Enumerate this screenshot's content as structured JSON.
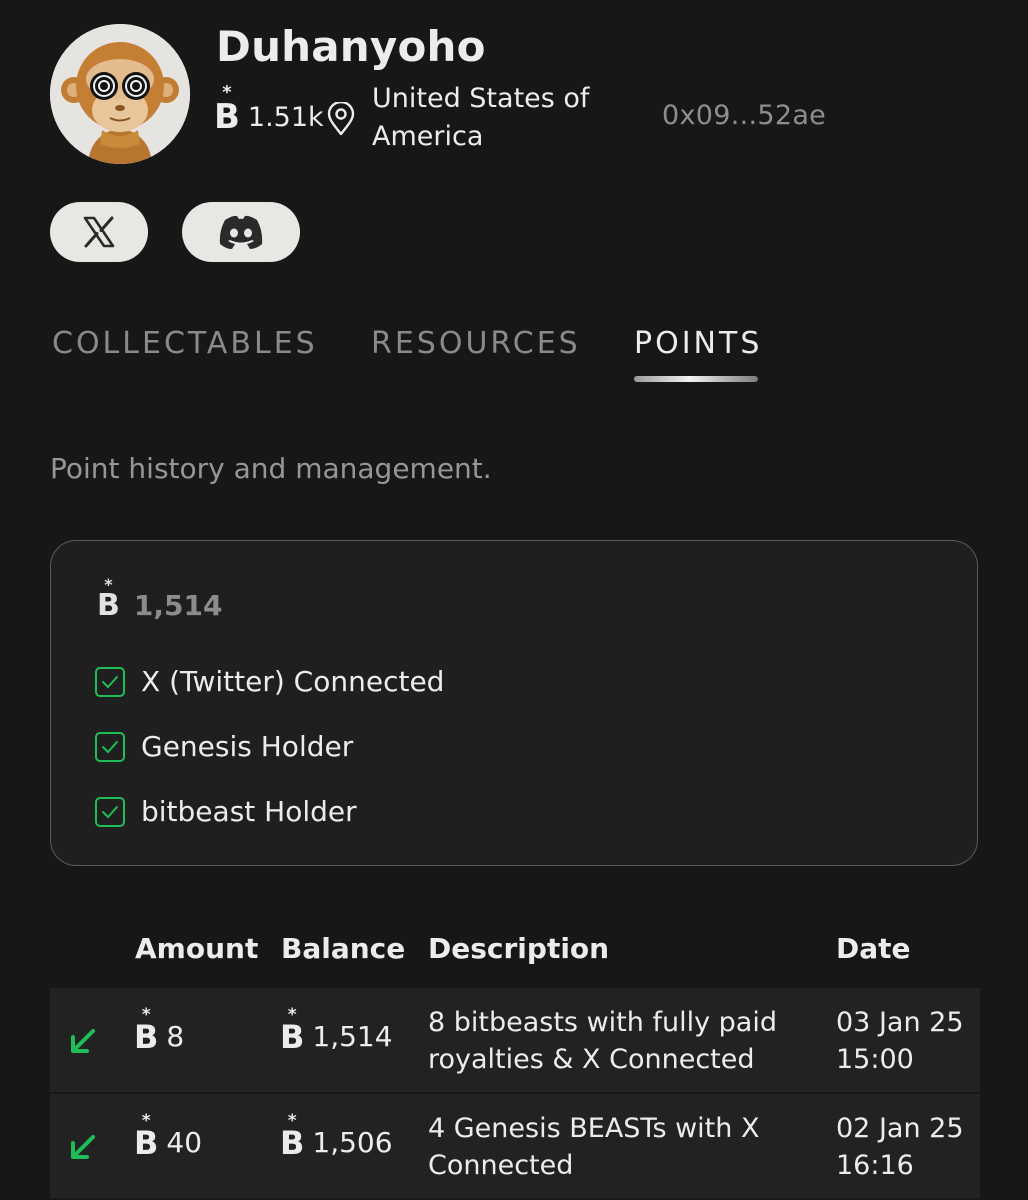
{
  "profile": {
    "name": "Duhanyoho",
    "points": "1.51k",
    "location": "United States of America",
    "wallet": "0x09...52ae"
  },
  "social": {
    "x_icon": "x-logo-icon",
    "discord_icon": "discord-logo-icon"
  },
  "tabs": [
    {
      "label": "COLLECTABLES",
      "active": false
    },
    {
      "label": "RESOURCES",
      "active": false
    },
    {
      "label": "POINTS",
      "active": true
    }
  ],
  "points_page": {
    "subtitle": "Point history and management.",
    "total": "1,514",
    "checks": [
      {
        "label": "X (Twitter) Connected",
        "checked": true
      },
      {
        "label": "Genesis Holder",
        "checked": true
      },
      {
        "label": "bitbeast Holder",
        "checked": true
      }
    ]
  },
  "history": {
    "headers": {
      "amount": "Amount",
      "balance": "Balance",
      "description": "Description",
      "date": "Date"
    },
    "rows": [
      {
        "direction": "incoming",
        "amount": "8",
        "balance": "1,514",
        "description": "8 bitbeasts with fully paid royalties & X Connected",
        "date": "03 Jan 25 15:00"
      },
      {
        "direction": "incoming",
        "amount": "40",
        "balance": "1,506",
        "description": "4 Genesis BEASTs with X Connected",
        "date": "02 Jan 25 16:16"
      }
    ]
  },
  "colors": {
    "background": "#171717",
    "card": "#1f1f1f",
    "accent_green": "#1fbd56",
    "muted_text": "#8e8e8e"
  }
}
